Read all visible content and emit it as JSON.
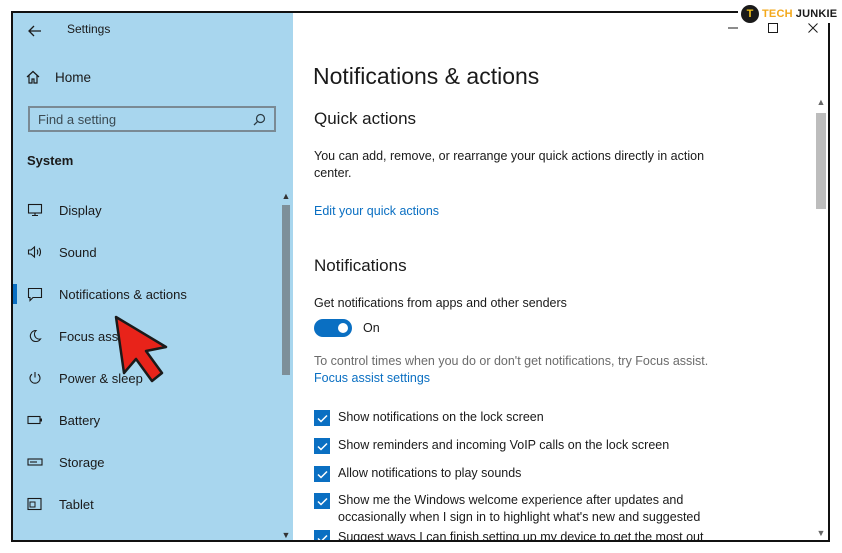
{
  "window": {
    "app_title": "Settings"
  },
  "watermark": {
    "badge": "T",
    "brand_part1": "TECH",
    "brand_part2": "JUNKIE"
  },
  "sidebar": {
    "home_label": "Home",
    "search_placeholder": "Find a setting",
    "section_label": "System",
    "items": [
      {
        "label": "Display",
        "icon": "monitor-icon"
      },
      {
        "label": "Sound",
        "icon": "speaker-icon"
      },
      {
        "label": "Notifications & actions",
        "icon": "message-icon",
        "active": true
      },
      {
        "label": "Focus assist",
        "icon": "moon-icon"
      },
      {
        "label": "Power & sleep",
        "icon": "power-icon"
      },
      {
        "label": "Battery",
        "icon": "battery-icon"
      },
      {
        "label": "Storage",
        "icon": "storage-icon"
      },
      {
        "label": "Tablet",
        "icon": "tablet-icon"
      }
    ]
  },
  "main": {
    "page_title": "Notifications & actions",
    "quick_actions": {
      "heading": "Quick actions",
      "description": "You can add, remove, or rearrange your quick actions directly in action center.",
      "link": "Edit your quick actions"
    },
    "notifications": {
      "heading": "Notifications",
      "toggle_caption": "Get notifications from apps and other senders",
      "toggle_state": "On",
      "focus_hint": "To control times when you do or don't get notifications, try Focus assist.",
      "focus_link": "Focus assist settings",
      "checkboxes": [
        {
          "label": "Show notifications on the lock screen",
          "checked": true
        },
        {
          "label": "Show reminders and incoming VoIP calls on the lock screen",
          "checked": true
        },
        {
          "label": "Allow notifications to play sounds",
          "checked": true
        },
        {
          "label": "Show me the Windows welcome experience after updates and occasionally when I sign in to highlight what's new and suggested",
          "checked": true
        },
        {
          "label": "Suggest ways I can finish setting up my device to get the most out",
          "checked": true
        }
      ]
    }
  },
  "colors": {
    "sidebar_bg": "#a8d6ee",
    "accent": "#0a6fc2",
    "annotation_arrow": "#e8231a"
  }
}
